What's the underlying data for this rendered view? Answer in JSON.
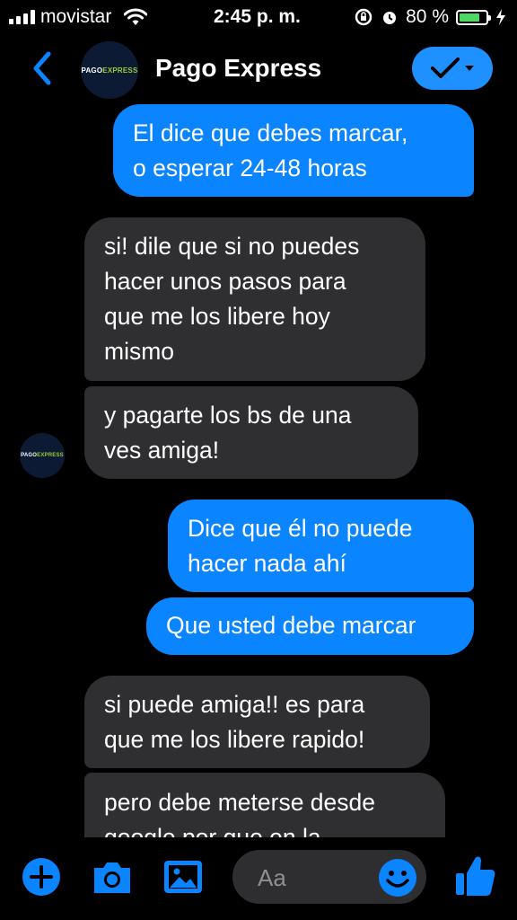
{
  "status_bar": {
    "carrier": "movistar",
    "time": "2:45 p. m.",
    "battery": "80 %",
    "battery_level": 0.8
  },
  "header": {
    "title": "Pago Express",
    "avatar_logo": {
      "prefix": "PAGO",
      "suffix": "EXPRESS"
    }
  },
  "messages": [
    {
      "from": "me",
      "lines": [
        "El dice que debes marcar,",
        "o esperar 24-48 horas"
      ]
    },
    {
      "from": "them",
      "lines": [
        "si! dile que si no puedes",
        "hacer unos pasos para",
        "que me los libere hoy",
        "mismo"
      ]
    },
    {
      "from": "them",
      "lines": [
        "y pagarte los bs de una",
        "ves amiga!"
      ]
    },
    {
      "from": "me",
      "lines": [
        "Dice que él no puede",
        "hacer nada ahí"
      ]
    },
    {
      "from": "me",
      "lines": [
        "Que usted debe marcar"
      ]
    },
    {
      "from": "them",
      "lines": [
        "si puede amiga!! es para",
        "que me los libere rapido!"
      ]
    },
    {
      "from": "them",
      "lines": [
        "pero debe meterse desde",
        "google por que en la"
      ]
    }
  ],
  "composer": {
    "placeholder": "Aa"
  },
  "colors": {
    "accent": "#0a84ff",
    "incoming_bubble": "#2f2f31",
    "background": "#000000",
    "battery": "#4cd964"
  }
}
